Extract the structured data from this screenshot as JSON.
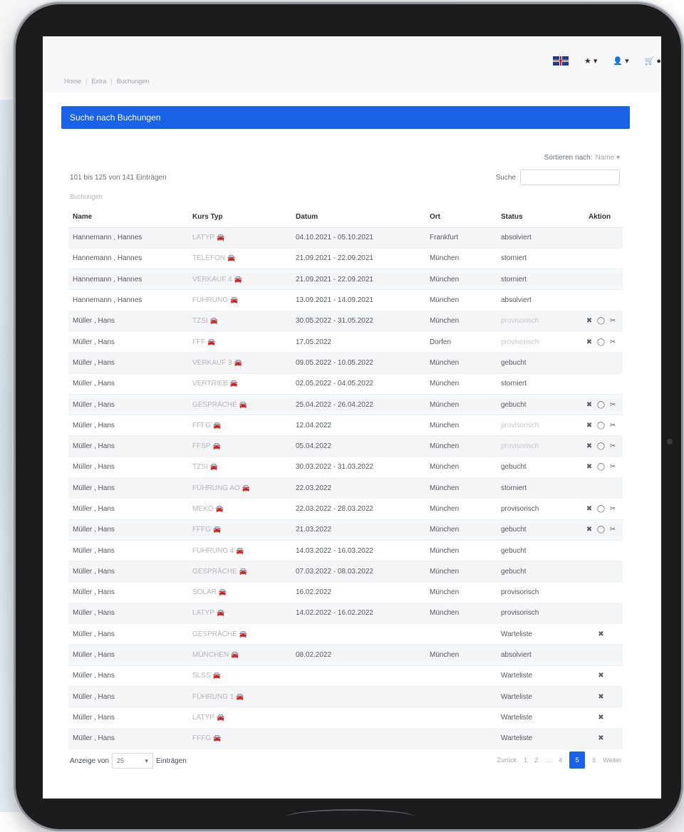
{
  "topbar": {
    "language_icon": "uk-flag-icon",
    "favorites_label": "★ ▾",
    "user_label": "▾",
    "cart_label": "●"
  },
  "breadcrumb": [
    "Home",
    "Extra",
    "Buchungen"
  ],
  "banner": {
    "title": "Suche nach Buchungen"
  },
  "list": {
    "sort_label": "Sortieren nach:",
    "sort_value": "Name",
    "info": "101 bis 125 von 141 Einträgen",
    "search_label": "Suche",
    "search_value": "",
    "caption": "Buchungen",
    "columns": [
      "Name",
      "Kurs Typ",
      "Datum",
      "Ort",
      "Status",
      "Aktion"
    ],
    "rows": [
      {
        "name": "Hannemann , Hannes",
        "course": "LATYP",
        "date": "04.10.2021 - 05.10.2021",
        "place": "Frankfurt",
        "status": "absolviert",
        "actions": ""
      },
      {
        "name": "Hannemann , Hannes",
        "course": "TELEFON",
        "date": "21.09.2021 - 22.09.2021",
        "place": "München",
        "status": "storniert",
        "actions": ""
      },
      {
        "name": "Hannemann , Hannes",
        "course": "VERKAUF 4",
        "date": "21.09.2021 - 22.09.2021",
        "place": "München",
        "status": "storniert",
        "actions": ""
      },
      {
        "name": "Hannemann , Hannes",
        "course": "FÜHRUNG",
        "date": "13.09.2021 - 14.09.2021",
        "place": "München",
        "status": "absolviert",
        "actions": ""
      },
      {
        "name": "Müller , Hans",
        "course": "TZSI",
        "date": "30.05.2022 - 31.05.2022",
        "place": "München",
        "status": "provisorisch",
        "status_faded": true,
        "actions": "✖ ◯ ✂"
      },
      {
        "name": "Müller , Hans",
        "course": "FFF",
        "date": "17.05.2022",
        "place": "Dorfen",
        "status": "provisorisch",
        "status_faded": true,
        "actions": "✖ ◯ ✂"
      },
      {
        "name": "Müller , Hans",
        "course": "VERKAUF 3",
        "date": "09.05.2022 - 10.05.2022",
        "place": "München",
        "status": "gebucht",
        "actions": ""
      },
      {
        "name": "Müller , Hans",
        "course": "VERTRIEB",
        "date": "02.05.2022 - 04.05.2022",
        "place": "München",
        "status": "storniert",
        "actions": ""
      },
      {
        "name": "Müller , Hans",
        "course": "GESPRÄCHE",
        "date": "25.04.2022 - 26.04.2022",
        "place": "München",
        "status": "gebucht",
        "actions": "✖ ◯ ✂"
      },
      {
        "name": "Müller , Hans",
        "course": "FFFG",
        "date": "12.04.2022",
        "place": "München",
        "status": "provisorisch",
        "status_faded": true,
        "actions": "✖ ◯ ✂"
      },
      {
        "name": "Müller , Hans",
        "course": "FFSP",
        "date": "05.04.2022",
        "place": "München",
        "status": "provisorisch",
        "status_faded": true,
        "actions": "✖ ◯ ✂"
      },
      {
        "name": "Müller , Hans",
        "course": "TZSI",
        "date": "30.03.2022 - 31.03.2022",
        "place": "München",
        "status": "gebucht",
        "actions": "✖ ◯ ✂"
      },
      {
        "name": "Müller , Hans",
        "course": "FÜHRUNG AO",
        "date": "22.03.2022",
        "place": "München",
        "status": "storniert",
        "actions": ""
      },
      {
        "name": "Müller , Hans",
        "course": "MEKO",
        "date": "22.03.2022 - 28.03.2022",
        "place": "München",
        "status": "provisorisch",
        "actions": "✖ ◯ ✂"
      },
      {
        "name": "Müller , Hans",
        "course": "FFFG",
        "date": "21.03.2022",
        "place": "München",
        "status": "gebucht",
        "actions": "✖ ◯ ✂"
      },
      {
        "name": "Müller , Hans",
        "course": "FÜHRUNG 4",
        "date": "14.03.2022 - 16.03.2022",
        "place": "München",
        "status": "gebucht",
        "actions": ""
      },
      {
        "name": "Müller , Hans",
        "course": "GESPRÄCHE",
        "date": "07.03.2022 - 08.03.2022",
        "place": "München",
        "status": "gebucht",
        "actions": ""
      },
      {
        "name": "Müller , Hans",
        "course": "SOLAR",
        "date": "16.02.2022",
        "place": "München",
        "status": "provisorisch",
        "actions": ""
      },
      {
        "name": "Müller , Hans",
        "course": "LATYP",
        "date": "14.02.2022 - 16.02.2022",
        "place": "München",
        "status": "provisorisch",
        "actions": ""
      },
      {
        "name": "Müller , Hans",
        "course": "GESPRÄCHE",
        "date": "",
        "place": "",
        "status": "Warteliste",
        "actions": "✖"
      },
      {
        "name": "Müller , Hans",
        "course": "MÜNCHEN",
        "date": "08.02.2022",
        "place": "München",
        "status": "absolviert",
        "actions": ""
      },
      {
        "name": "Müller , Hans",
        "course": "SLSS",
        "date": "",
        "place": "",
        "status": "Warteliste",
        "actions": "✖"
      },
      {
        "name": "Müller , Hans",
        "course": "FÜHRUNG 1",
        "date": "",
        "place": "",
        "status": "Warteliste",
        "actions": "✖"
      },
      {
        "name": "Müller , Hans",
        "course": "LATYP",
        "date": "",
        "place": "",
        "status": "Warteliste",
        "actions": "✖"
      },
      {
        "name": "Müller , Hans",
        "course": "FFFG",
        "date": "",
        "place": "",
        "status": "Warteliste",
        "actions": "✖"
      }
    ],
    "show_label": "Anzeige von",
    "page_size": "25",
    "show_suffix": "Einträgen",
    "pager": {
      "prev": "Zurück",
      "pages": [
        "1",
        "2",
        "…",
        "4"
      ],
      "active": "5",
      "after": "6",
      "next": "Weiter"
    }
  }
}
